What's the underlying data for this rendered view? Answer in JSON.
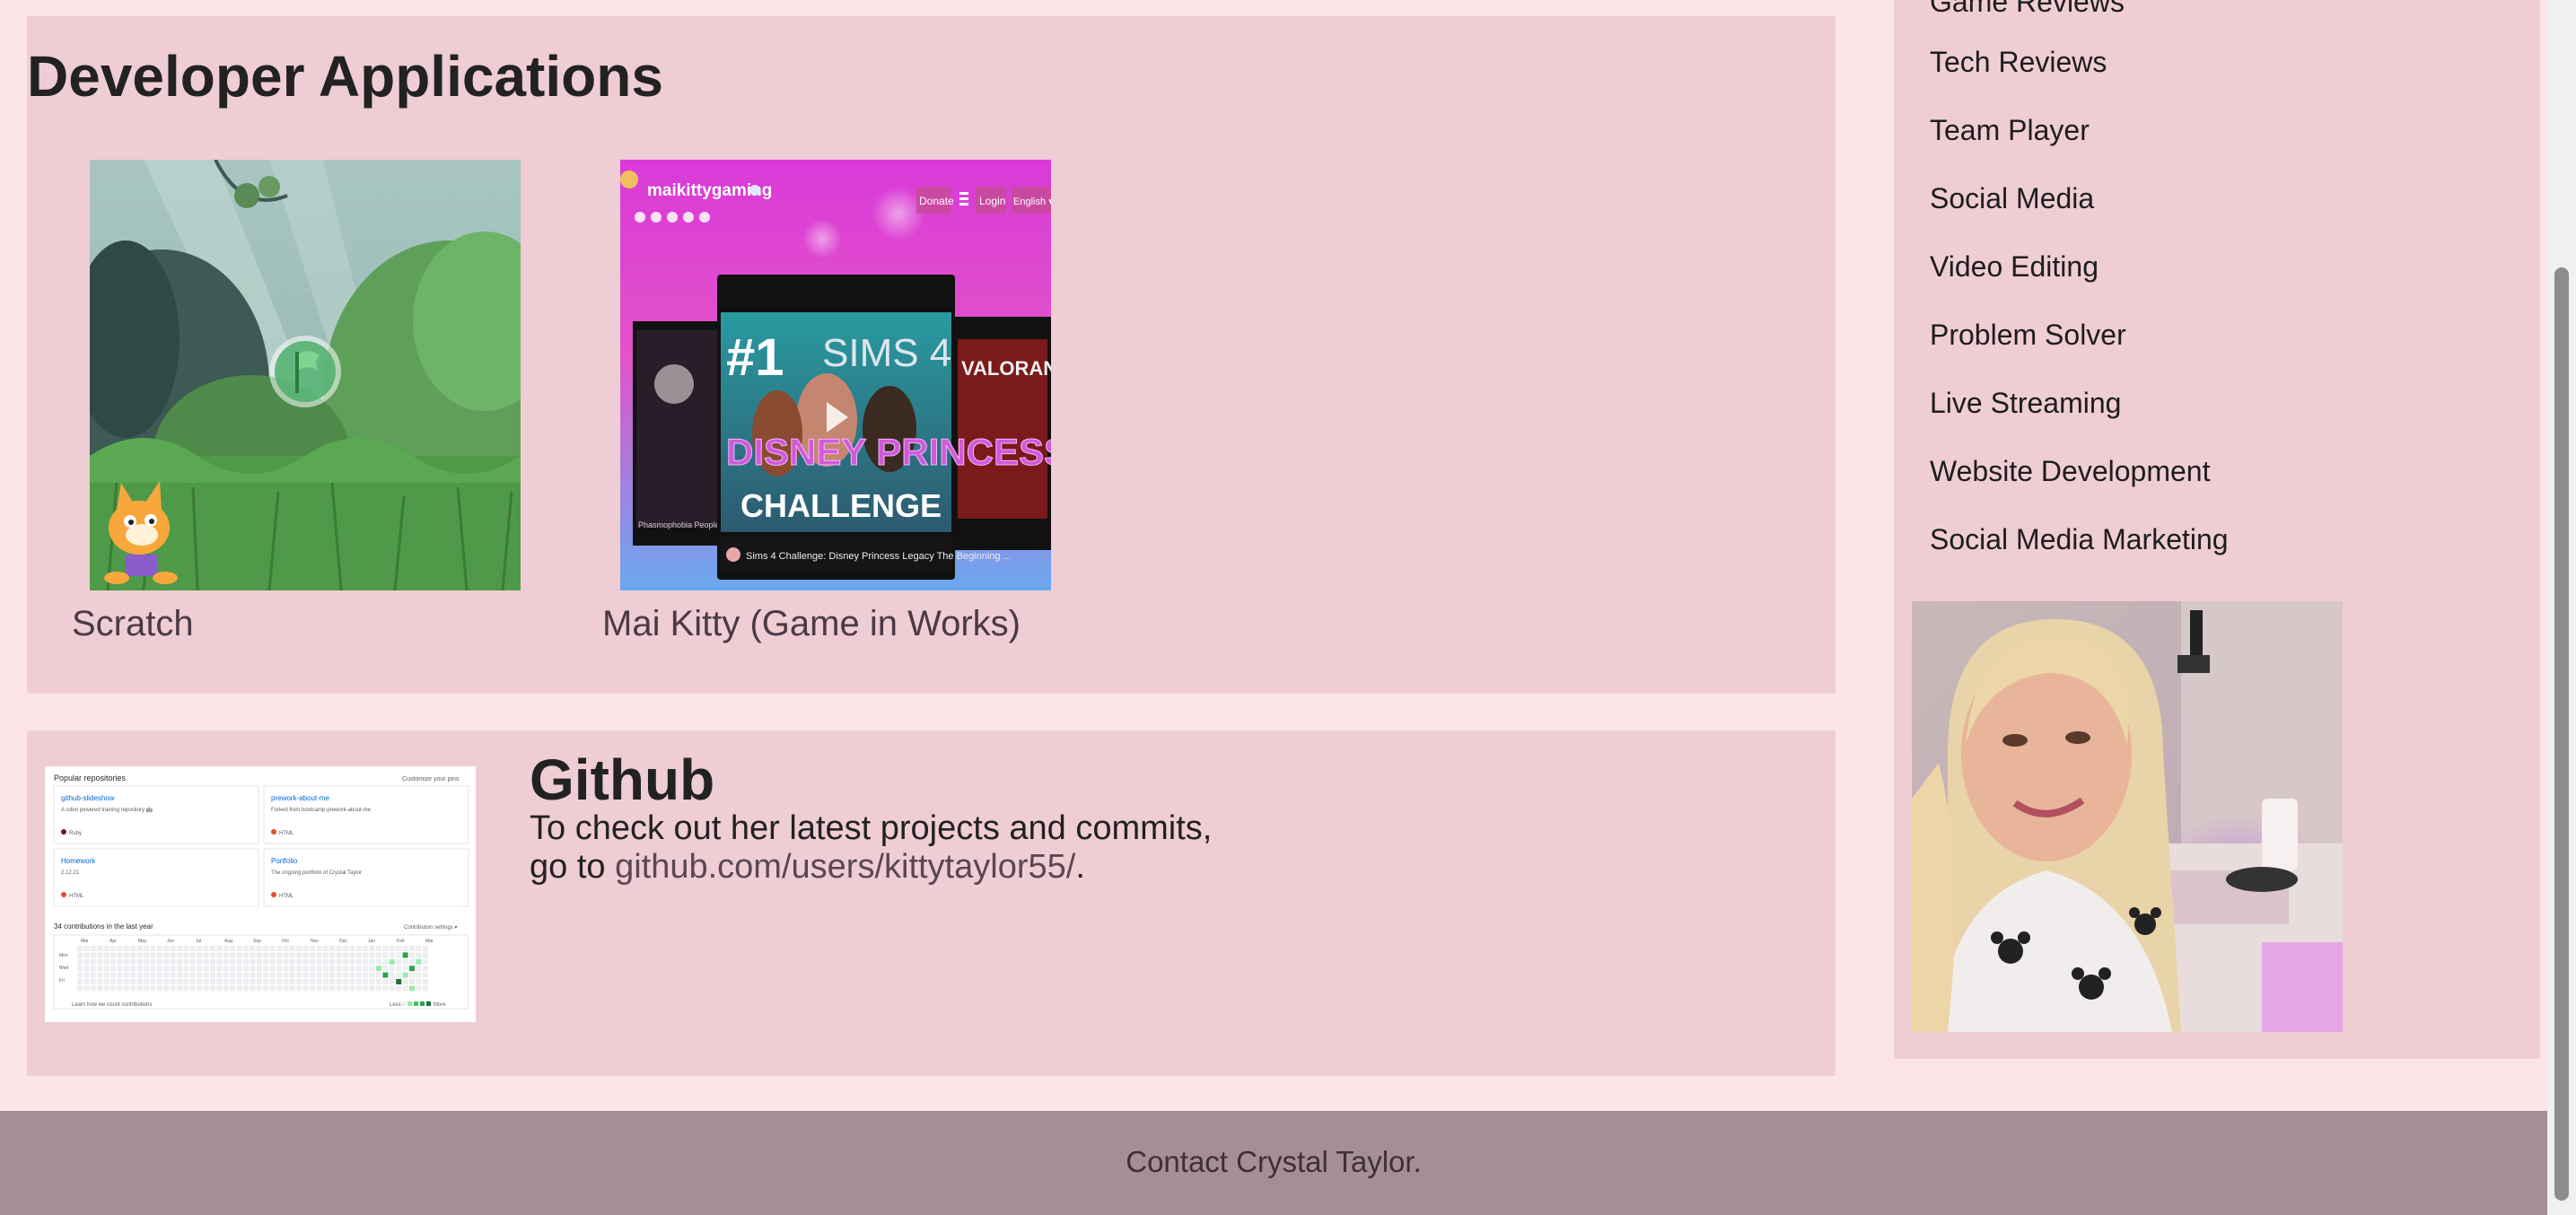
{
  "developer_section": {
    "title": "Developer Applications",
    "apps": [
      {
        "caption": "Scratch"
      },
      {
        "caption": "Mai Kitty (Game in Works)"
      }
    ],
    "maikitty_screenshot": {
      "site_name": "maikittygaming",
      "nav": [
        "Donate",
        "Login",
        "English ▾"
      ],
      "rank": "#1",
      "banner_top": "SIMS 4",
      "banner_title": "DISNEY PRINCESS",
      "banner_sub": "CHALLENGE",
      "side_label": "VALORANT",
      "video_caption": "Sims 4 Challenge: Disney Princess Legacy The Beginning ...",
      "left_caption": "Phasmophobia People Im"
    }
  },
  "github_section": {
    "title": "Github",
    "text_line1": "To check out her latest projects and commits,",
    "text_line2_prefix": "go to ",
    "link": "github.com/users/kittytaylor55/",
    "text_line2_suffix": ".",
    "screenshot": {
      "header": "Popular repositories",
      "customize": "Customize your pins",
      "repos": [
        {
          "name": "github-slideshow",
          "desc": "A robot powered training repository 🤖",
          "lang": "Ruby"
        },
        {
          "name": "prework-about-me",
          "desc": "Forked from bootcamp-prework-about-me",
          "lang": "HTML"
        },
        {
          "name": "Homework",
          "desc": "2.12.21",
          "lang": "HTML"
        },
        {
          "name": "Portfolio",
          "desc": "The ongoing portfolio of Crystal Taylor",
          "lang": "HTML"
        }
      ],
      "contrib_title": "34 contributions in the last year",
      "contrib_settings": "Contribution settings ▾",
      "months": [
        "Mar",
        "Apr",
        "May",
        "Jun",
        "Jul",
        "Aug",
        "Sep",
        "Oct",
        "Nov",
        "Dec",
        "Jan",
        "Feb",
        "Mar"
      ],
      "days": [
        "Mon",
        "Wed",
        "Fri"
      ],
      "learn": "Learn how we count contributions",
      "less": "Less",
      "more": "More"
    }
  },
  "sidebar": {
    "items": [
      "Game Reviews",
      "Tech Reviews",
      "Team Player",
      "Social Media",
      "Video Editing",
      "Problem Solver",
      "Live Streaming",
      "Website Development",
      "Social Media Marketing"
    ]
  },
  "footer": {
    "text": "Contact Crystal Taylor."
  },
  "colors": {
    "page_bg": "#fbe5e6",
    "panel_bg": "#efcdd4",
    "footer_bg": "#a58f94",
    "link": "#5a4753"
  }
}
